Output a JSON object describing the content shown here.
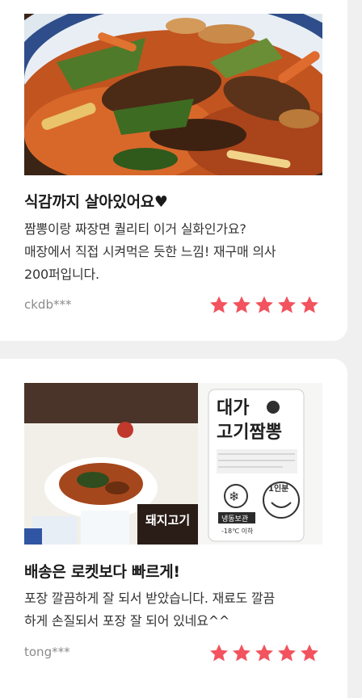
{
  "reviews": [
    {
      "title": "식감까지 살아있어요♥",
      "body_lines": [
        "짬뽕이랑 짜장면 퀄리티 이거 실화인가요?",
        "매장에서 직접 시켜먹은 듯한 느낌! 재구매 의사",
        "200퍼입니다."
      ],
      "reviewer": "ckdb***",
      "rating": 5,
      "photo_icon": "jjajang-stirfry-photo"
    },
    {
      "title": "배송은 로켓보다 빠르게!",
      "body_lines": [
        "포장 깔끔하게 잘 되서 받았습니다. 재료도 깔끔",
        "하게 손질되서 포장 잘 되어 있네요^^"
      ],
      "reviewer": "tong***",
      "rating": 5,
      "photo_icon": "packaged-product-photo",
      "package_text": {
        "brand": "대가",
        "name": "고기짬뽕",
        "servings": "1인분",
        "storage": "냉동보관",
        "temp": "-18℃ 이하",
        "box_label": "돼지고기"
      }
    }
  ],
  "colors": {
    "star": "#f2535e",
    "background": "#f0f0f0",
    "card": "#ffffff"
  }
}
